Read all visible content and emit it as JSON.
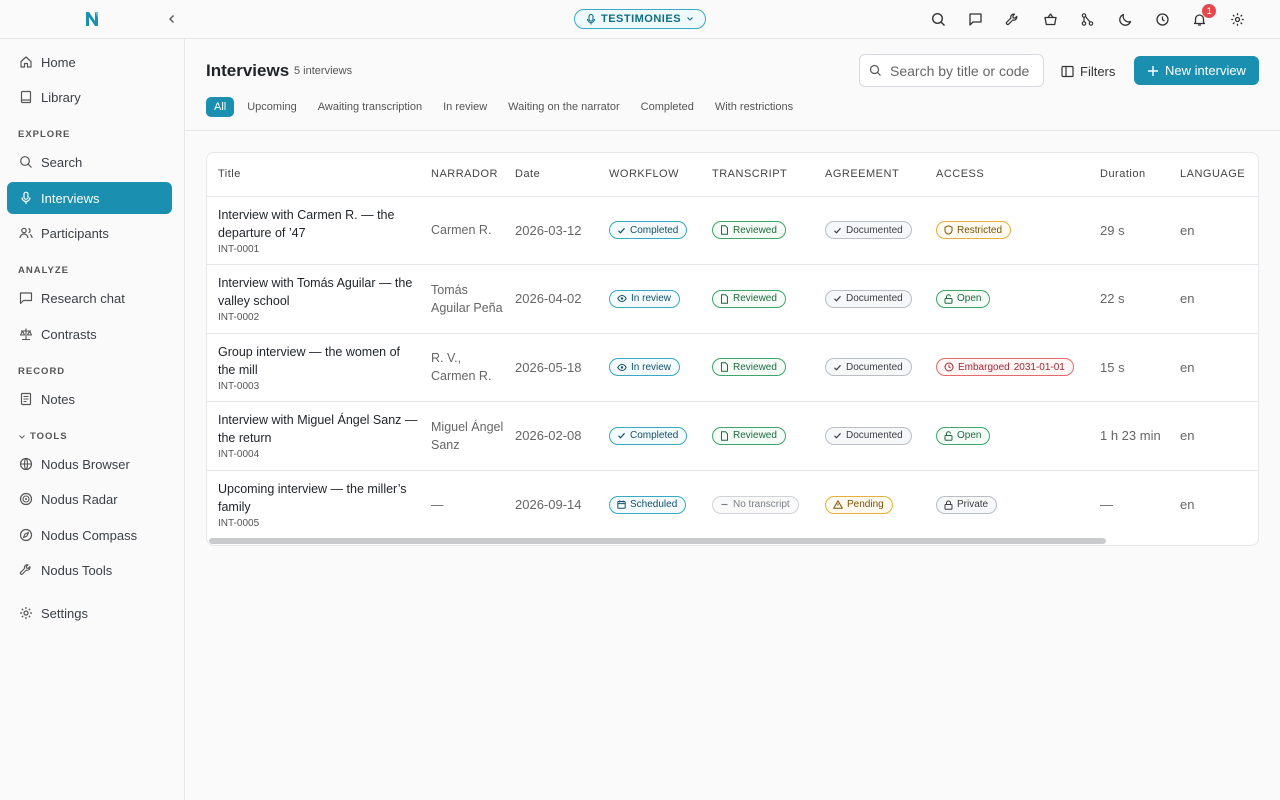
{
  "topbar": {
    "workspace": "TESTIMONIES",
    "notifications_count": "1",
    "icons": [
      "search-icon",
      "chat-icon",
      "tools-icon",
      "basket-icon",
      "git-icon",
      "moon-icon",
      "history-icon",
      "bell-icon",
      "gear-icon"
    ]
  },
  "sidebar": {
    "top_items": [
      {
        "label": "Home",
        "icon": "home-icon"
      },
      {
        "label": "Library",
        "icon": "book-icon"
      }
    ],
    "explore_label": "EXPLORE",
    "explore_items": [
      {
        "label": "Search",
        "icon": "search-icon"
      },
      {
        "label": "Interviews",
        "icon": "mic-icon"
      },
      {
        "label": "Participants",
        "icon": "users-icon"
      }
    ],
    "analyze_label": "ANALYZE",
    "analyze_items": [
      {
        "label": "Research chat",
        "icon": "chat-icon"
      },
      {
        "label": "Contrasts",
        "icon": "scale-icon"
      }
    ],
    "record_label": "RECORD",
    "record_items": [
      {
        "label": "Notes",
        "icon": "notes-icon"
      }
    ],
    "tools_label": "TOOLS",
    "tools_items": [
      {
        "label": "Nodus Browser",
        "icon": "globe-icon"
      },
      {
        "label": "Nodus Radar",
        "icon": "radar-icon"
      },
      {
        "label": "Nodus Compass",
        "icon": "compass-icon"
      },
      {
        "label": "Nodus Tools",
        "icon": "wrench-icon"
      }
    ],
    "settings_label": "Settings"
  },
  "header": {
    "title": "Interviews",
    "count": "5 interviews",
    "search_placeholder": "Search by title or code",
    "filters_label": "Filters",
    "new_label": "New interview",
    "tabs": [
      "All",
      "Upcoming",
      "Awaiting transcription",
      "In review",
      "Waiting on the narrator",
      "Completed",
      "With restrictions"
    ],
    "active_tab": "All"
  },
  "table": {
    "columns": [
      "Title",
      "NARRADOR",
      "Date",
      "WORKFLOW",
      "TRANSCRIPT",
      "AGREEMENT",
      "ACCESS",
      "Duration",
      "LANGUAGE"
    ],
    "rows": [
      {
        "title": "Interview with Carmen R. — the departure of ’47",
        "code": "INT-0001",
        "narrator": "Carmen R.",
        "date": "2026-03-12",
        "workflow": "Completed",
        "transcript": "Reviewed",
        "agreement": "Documented",
        "access": "Restricted",
        "access_extra": "",
        "duration": "29 s",
        "language": "en"
      },
      {
        "title": "Interview with Tomás Aguilar — the valley school",
        "code": "INT-0002",
        "narrator": "Tomás Aguilar Peña",
        "date": "2026-04-02",
        "workflow": "In review",
        "transcript": "Reviewed",
        "agreement": "Documented",
        "access": "Open",
        "access_extra": "",
        "duration": "22 s",
        "language": "en"
      },
      {
        "title": "Group interview — the women of the mill",
        "code": "INT-0003",
        "narrator": "R. V., Carmen R.",
        "date": "2026-05-18",
        "workflow": "In review",
        "transcript": "Reviewed",
        "agreement": "Documented",
        "access": "Embargoed",
        "access_extra": "2031-01-01",
        "duration": "15 s",
        "language": "en"
      },
      {
        "title": "Interview with Miguel Ángel Sanz — the return",
        "code": "INT-0004",
        "narrator": "Miguel Ángel Sanz",
        "date": "2026-02-08",
        "workflow": "Completed",
        "transcript": "Reviewed",
        "agreement": "Documented",
        "access": "Open",
        "access_extra": "",
        "duration": "1 h 23 min",
        "language": "en"
      },
      {
        "title": "Upcoming interview — the miller’s family",
        "code": "INT-0005",
        "narrator": "—",
        "date": "2026-09-14",
        "workflow": "Scheduled",
        "transcript": "No transcript",
        "agreement": "Pending",
        "access": "Private",
        "access_extra": "",
        "duration": "—",
        "language": "en"
      }
    ]
  }
}
